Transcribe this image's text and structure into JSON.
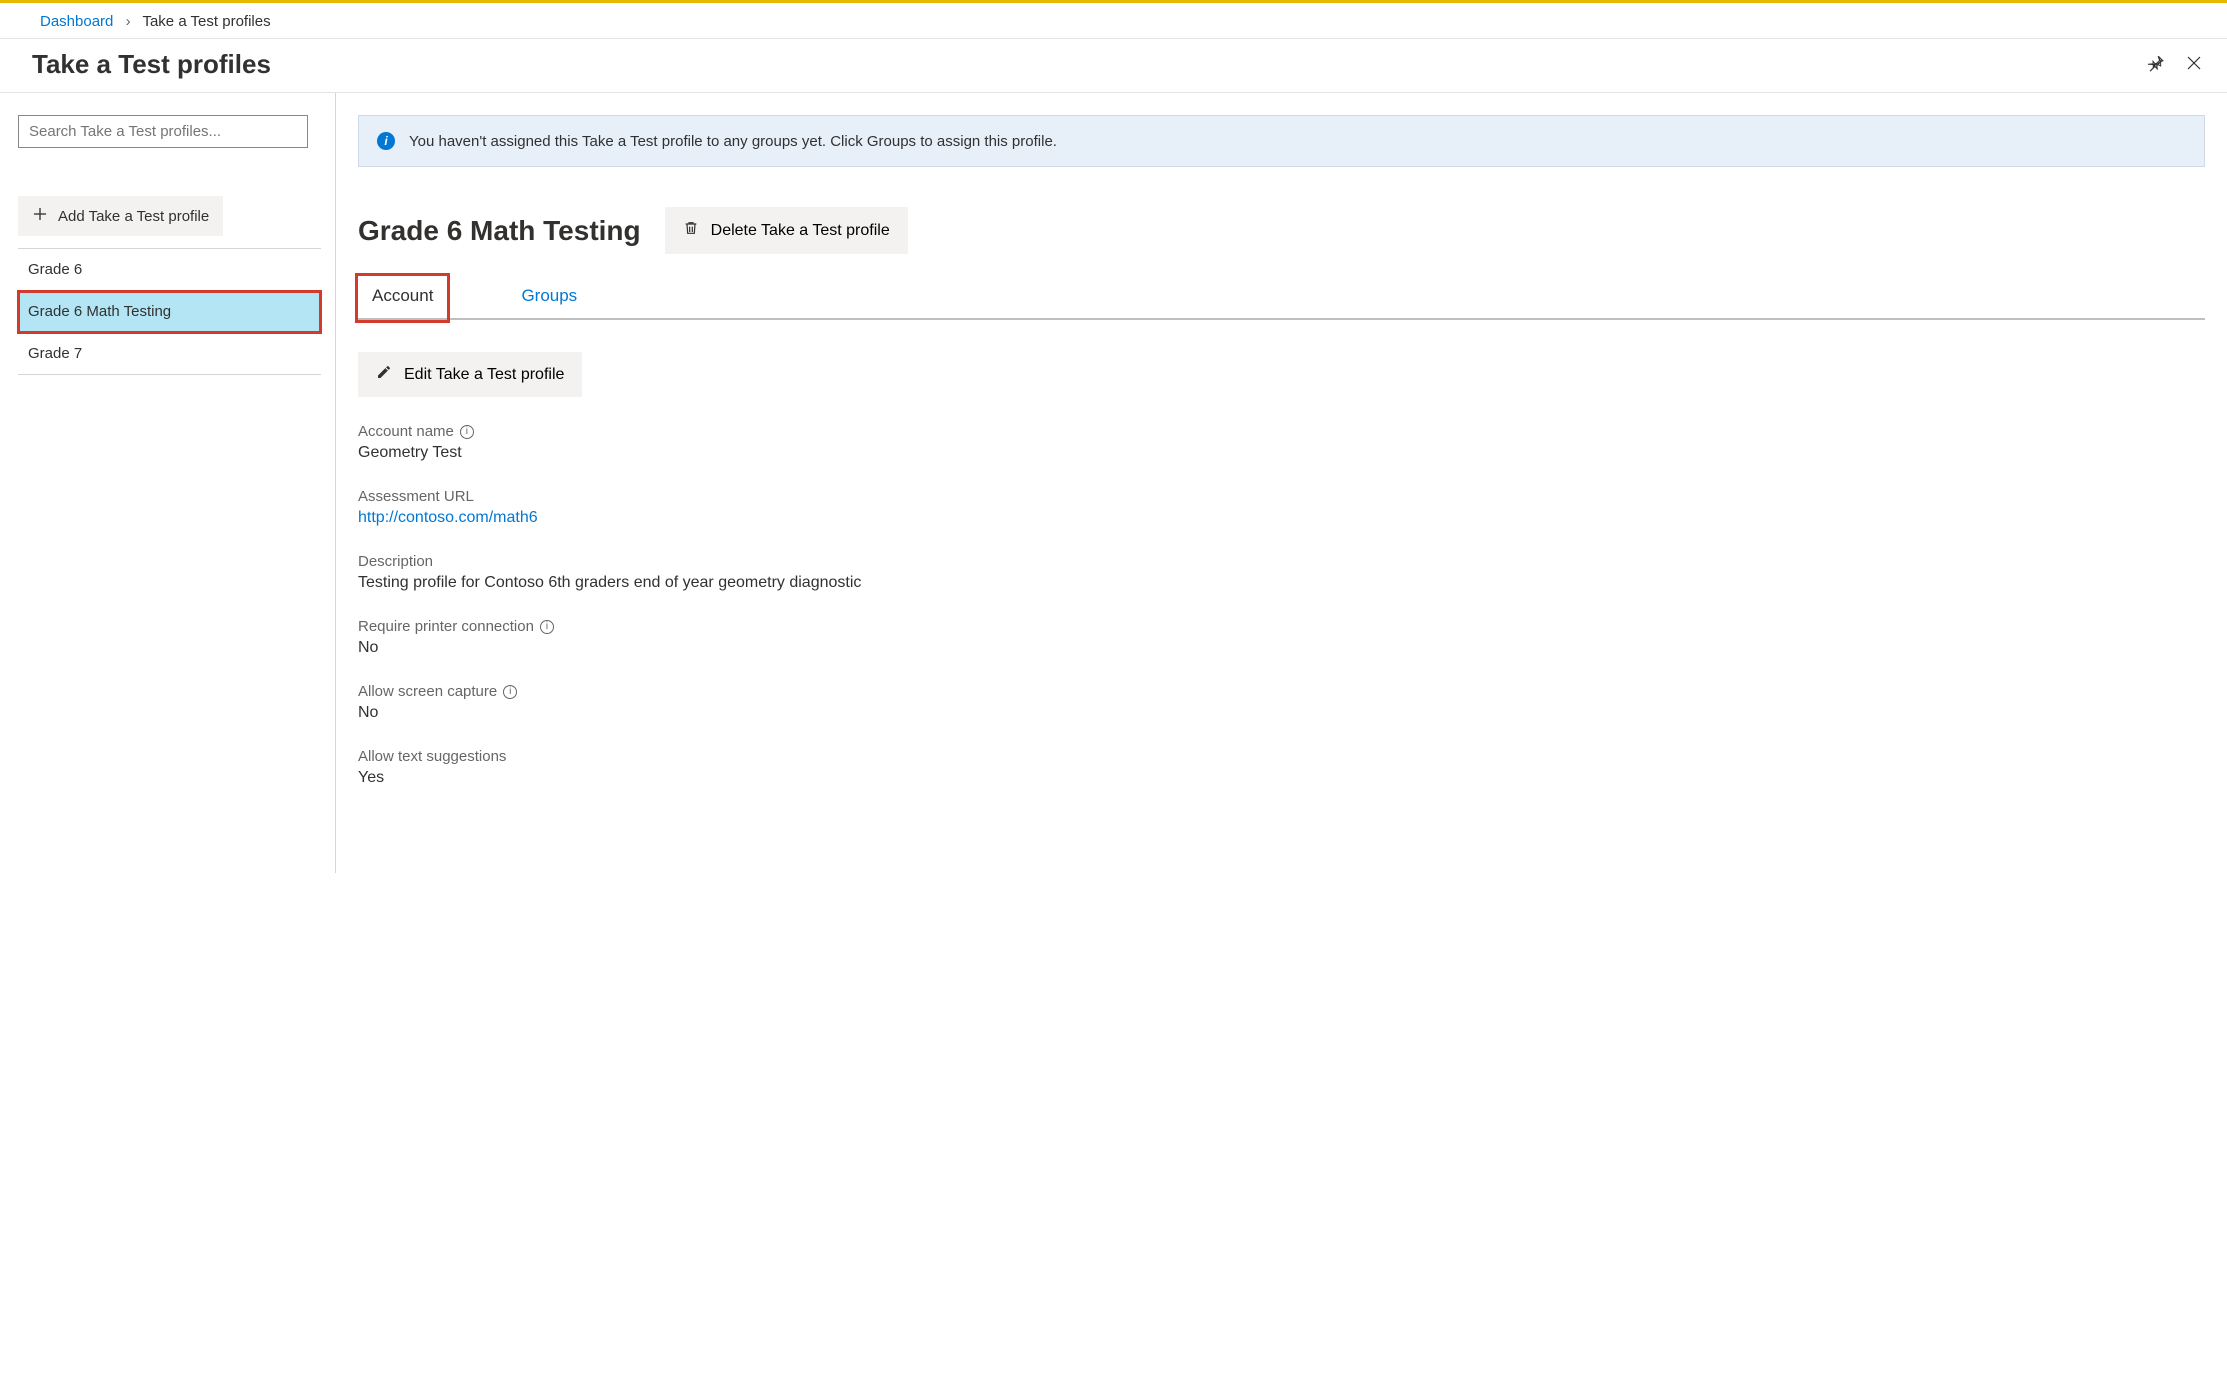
{
  "breadcrumb": {
    "root": "Dashboard",
    "current": "Take a Test profiles"
  },
  "page_title": "Take a Test profiles",
  "sidebar": {
    "search_placeholder": "Search Take a Test profiles...",
    "add_button": "Add Take a Test profile",
    "items": [
      {
        "label": "Grade 6",
        "selected": false
      },
      {
        "label": "Grade 6 Math Testing",
        "selected": true
      },
      {
        "label": "Grade 7",
        "selected": false
      }
    ]
  },
  "main": {
    "banner": "You haven't assigned this Take a Test profile to any groups yet. Click Groups to assign this profile.",
    "profile_title": "Grade 6 Math Testing",
    "delete_button": "Delete Take a Test profile",
    "tabs": {
      "account": "Account",
      "groups": "Groups"
    },
    "edit_button": "Edit Take a Test profile",
    "fields": {
      "account_name_label": "Account name",
      "account_name_value": "Geometry Test",
      "assessment_url_label": "Assessment URL",
      "assessment_url_value": "http://contoso.com/math6",
      "description_label": "Description",
      "description_value": "Testing profile for Contoso 6th graders end of year geometry diagnostic",
      "printer_label": "Require printer connection",
      "printer_value": "No",
      "screen_label": "Allow screen capture",
      "screen_value": "No",
      "suggestions_label": "Allow text suggestions",
      "suggestions_value": "Yes"
    }
  }
}
